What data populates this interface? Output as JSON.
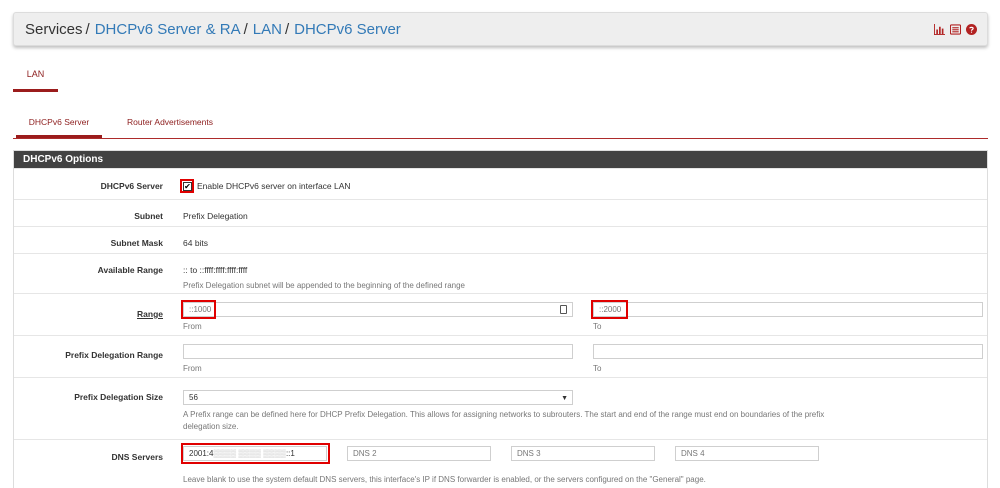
{
  "breadcrumb": {
    "items": [
      "Services",
      "DHCPv6 Server & RA",
      "LAN",
      "DHCPv6 Server"
    ],
    "separator": "/"
  },
  "header_icons": [
    "bar-chart-icon",
    "list-icon",
    "help-icon"
  ],
  "interface_tab": "LAN",
  "sub_tabs": [
    "DHCPv6 Server",
    "Router Advertisements"
  ],
  "panel": {
    "title": "DHCPv6 Options",
    "dhcpv6_server": {
      "label": "DHCPv6 Server",
      "checked": true,
      "check_mark": "✔",
      "checkbox_text": "Enable DHCPv6 server on interface LAN"
    },
    "subnet": {
      "label": "Subnet",
      "value": "Prefix Delegation"
    },
    "subnet_mask": {
      "label": "Subnet Mask",
      "value": "64 bits"
    },
    "available_range": {
      "label": "Available Range",
      "value": ":: to ::ffff:ffff:ffff:ffff",
      "help": "Prefix Delegation subnet will be appended to the beginning of the defined range"
    },
    "range": {
      "label": "Range",
      "from_value": "::1000",
      "from_help": "From",
      "to_value": "::2000",
      "to_help": "To"
    },
    "prefix_delegation_range": {
      "label": "Prefix Delegation Range",
      "from_value": "",
      "from_help": "From",
      "to_value": "",
      "to_help": "To"
    },
    "prefix_delegation_size": {
      "label": "Prefix Delegation Size",
      "selected": "56",
      "help_line1": "A Prefix range can be defined here for DHCP Prefix Delegation. This allows for assigning networks to subrouters. The start and end of the range must end on boundaries of the prefix",
      "help_line2": "delegation size."
    },
    "dns_servers": {
      "label": "DNS Servers",
      "dns1_prefix": "2001:4",
      "dns1_masked": "▒▒▒▒ ▒▒▒▒ ▒▒▒▒",
      "dns1_suffix": "::1",
      "dns2_placeholder": "DNS 2",
      "dns3_placeholder": "DNS 3",
      "dns4_placeholder": "DNS 4",
      "help": "Leave blank to use the system default DNS servers, this interface's IP if DNS forwarder is enabled, or the servers configured on the \"General\" page."
    }
  },
  "colors": {
    "accent": "#9b1c1c",
    "link": "#337ab7",
    "panel_header": "#424242",
    "highlight": "#e00000"
  }
}
